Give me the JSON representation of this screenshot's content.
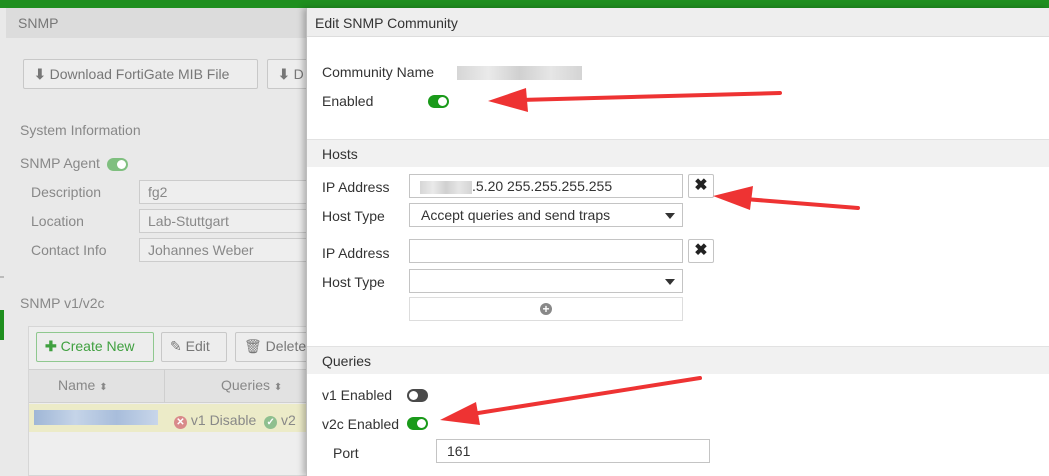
{
  "background": {
    "page_title": "SNMP",
    "toolbar": {
      "download_mib": "Download FortiGate MIB File",
      "download_other": "D"
    },
    "system_info": {
      "heading": "System Information",
      "snmp_agent_label": "SNMP Agent",
      "snmp_agent_enabled": true,
      "fields": [
        {
          "label": "Description",
          "value": "fg2"
        },
        {
          "label": "Location",
          "value": "Lab-Stuttgart"
        },
        {
          "label": "Contact Info",
          "value": "Johannes Weber"
        }
      ]
    },
    "v1v2c": {
      "heading": "SNMP v1/v2c",
      "create_new": "Create New",
      "edit": "Edit",
      "delete": "Delete",
      "columns": {
        "name": "Name",
        "queries": "Queries"
      },
      "row": {
        "v1_status": "v1 Disable",
        "v2_status": "v2"
      }
    }
  },
  "dialog": {
    "title": "Edit SNMP Community",
    "community_name_label": "Community Name",
    "enabled_label": "Enabled",
    "enabled": true,
    "hosts": {
      "heading": "Hosts",
      "entries": [
        {
          "ip_label": "IP Address",
          "ip_value": ".5.20 255.255.255.255",
          "type_label": "Host Type",
          "type_value": "Accept queries and send traps"
        },
        {
          "ip_label": "IP Address",
          "ip_value": "",
          "type_label": "Host Type",
          "type_value": ""
        }
      ]
    },
    "queries": {
      "heading": "Queries",
      "v1_label": "v1 Enabled",
      "v1_enabled": false,
      "v2c_label": "v2c Enabled",
      "v2c_enabled": true,
      "port_label": "Port",
      "port_value": "161"
    }
  },
  "colors": {
    "brand_green": "#1f8f1f",
    "toggle_on": "#1a9a1a",
    "annotation_arrow": "#ee3333"
  }
}
